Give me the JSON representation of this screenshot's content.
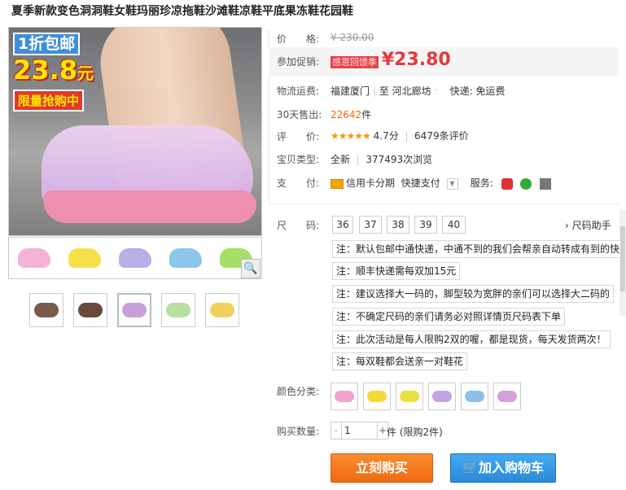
{
  "title": "夏季新款变色洞洞鞋女鞋玛丽珍凉拖鞋沙滩鞋凉鞋平底果冻鞋花园鞋",
  "promo_image": {
    "line1": "1折包邮",
    "line2_num": "23.8",
    "line2_unit": "元",
    "line3": "限量抢购中"
  },
  "price": {
    "label": "价　　格:",
    "value": "¥ 230.00"
  },
  "promotion": {
    "label": "参加促销:",
    "tag": "感恩回馈季",
    "currency": "¥",
    "value": "23.80"
  },
  "shipping": {
    "label": "物流运费:",
    "from": "福建厦门",
    "sep": "|",
    "to_prefix": "至",
    "to": "河北廊坊",
    "fee": "快递: 免运费"
  },
  "sales": {
    "label": "30天售出:",
    "count": "22642",
    "unit": "件"
  },
  "rating": {
    "label": "评　　价:",
    "stars": "★★★★★",
    "score": "4.7分",
    "sep": "|",
    "reviews": "6479条评价"
  },
  "type": {
    "label": "宝贝类型:",
    "value": "全新",
    "sep": "|",
    "views": "377493次浏览"
  },
  "payment": {
    "label": "支　　付:",
    "method1": "信用卡分期",
    "method2": "快捷支付",
    "service_label": "服务:"
  },
  "size": {
    "label": "尺　　码:",
    "options": [
      "36",
      "37",
      "38",
      "39",
      "40"
    ],
    "helper": "尺码助手"
  },
  "notes": [
    "注：默认包邮中通快递，中通不到的我们会帮亲自动转成有到的快递",
    "注：顺丰快递需每双加15元",
    "注：建议选择大一码的，脚型较为宽胖的亲们可以选择大二码的",
    "注：不确定尺码的亲们请务必对照详情页尺码表下单",
    "注：此次活动是每人限购2双的喔，都是现货，每天发货两次！",
    "注：每双鞋都会送亲一对鞋花"
  ],
  "colors": {
    "label": "颜色分类:"
  },
  "quantity": {
    "label": "购买数量:",
    "minus": "-",
    "value": "1",
    "plus": "+",
    "unit": "件",
    "limit": "(限购2件)"
  },
  "buttons": {
    "buy": "立刻购买",
    "cart": "加入购物车"
  },
  "icons": {
    "zoom": "magnifier-icon",
    "cart": "cart-icon"
  }
}
